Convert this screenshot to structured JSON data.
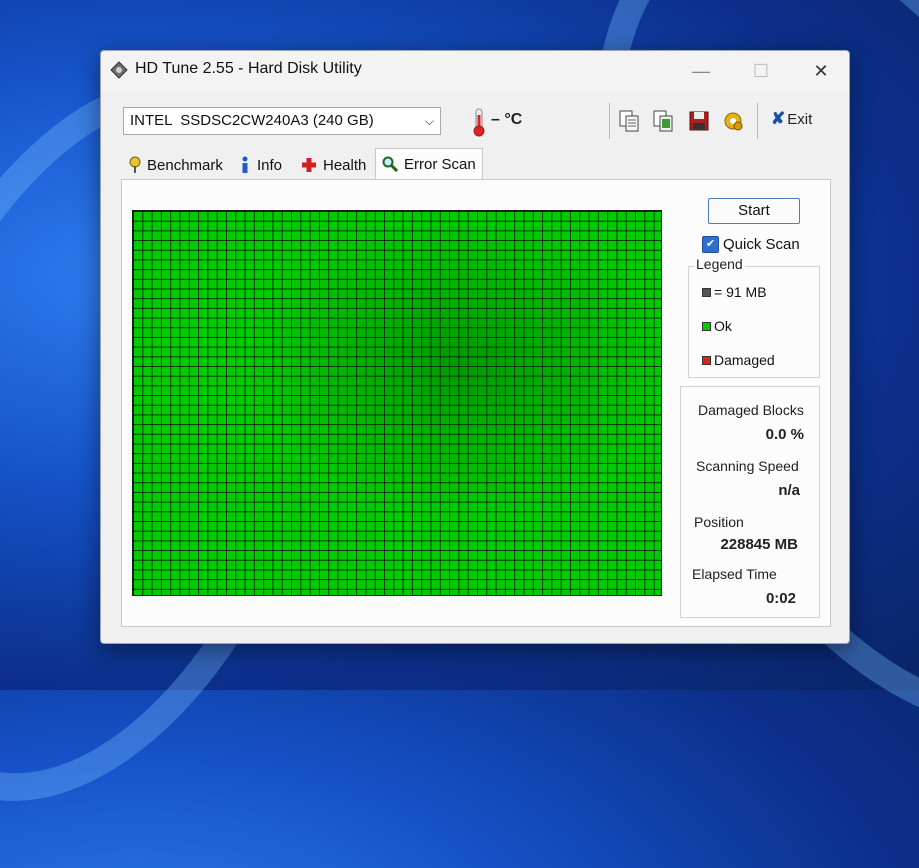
{
  "window": {
    "title": "HD Tune 2.55 - Hard Disk Utility",
    "minimize_glyph": "—",
    "maximize_glyph": "☐",
    "close_glyph": "✕"
  },
  "toolbar": {
    "drive": "INTEL  SSDSC2CW240A3 (240 GB)",
    "temperature": "– °C",
    "exit_label": "Exit",
    "exit_glyph": "✘"
  },
  "tabs": [
    {
      "label": "Benchmark",
      "icon": "gauge-icon"
    },
    {
      "label": "Info",
      "icon": "info-icon"
    },
    {
      "label": "Health",
      "icon": "health-cross-icon"
    },
    {
      "label": "Error Scan",
      "icon": "magnifier-icon",
      "active": true
    }
  ],
  "scan": {
    "start_label": "Start",
    "quick_scan_label": "Quick Scan",
    "quick_scan_checked": true
  },
  "legend": {
    "title": "Legend",
    "block_size": "= 91 MB",
    "ok": "Ok",
    "damaged": "Damaged",
    "colors": {
      "block": "#555555",
      "ok": "#00cc00",
      "damaged": "#dd2222"
    }
  },
  "stats": {
    "damaged_blocks_label": "Damaged Blocks",
    "damaged_blocks_value": "0.0 %",
    "scanning_speed_label": "Scanning Speed",
    "scanning_speed_value": "n/a",
    "position_label": "Position",
    "position_value": "228845 MB",
    "elapsed_label": "Elapsed Time",
    "elapsed_value": "0:02"
  }
}
